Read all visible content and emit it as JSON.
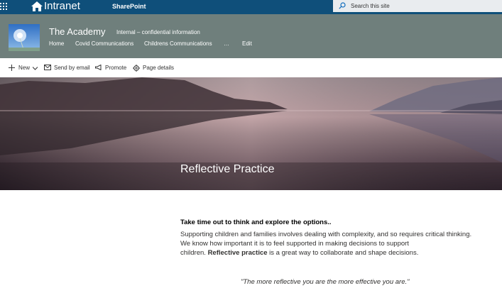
{
  "suite": {
    "app_name": "Intranet",
    "product": "SharePoint",
    "search_placeholder": "Search this site"
  },
  "site": {
    "title": "The Academy",
    "classification": "Internal – confidential information",
    "nav": [
      "Home",
      "Covid Communications",
      "Childrens Communications",
      "…",
      "Edit"
    ]
  },
  "commands": {
    "new": "New",
    "send_by_email": "Send by email",
    "promote": "Promote",
    "page_details": "Page details"
  },
  "hero": {
    "title": "Reflective Practice"
  },
  "content": {
    "lead": "Take time out to think and explore the options..",
    "line1": "Supporting children and families involves dealing with complexity, and so requires critical thinking.",
    "line2": "We know how important it is to feel supported in making decisions to support",
    "line3_pre": "children. ",
    "line3_bold": "Reflective practice",
    "line3_post": " is a great way to collaborate and shape decisions.",
    "quote": "\"The more reflective you are the more effective you are.\""
  },
  "colors": {
    "suite_bar": "#0f4f7a",
    "site_header": "#6f7f7c"
  }
}
